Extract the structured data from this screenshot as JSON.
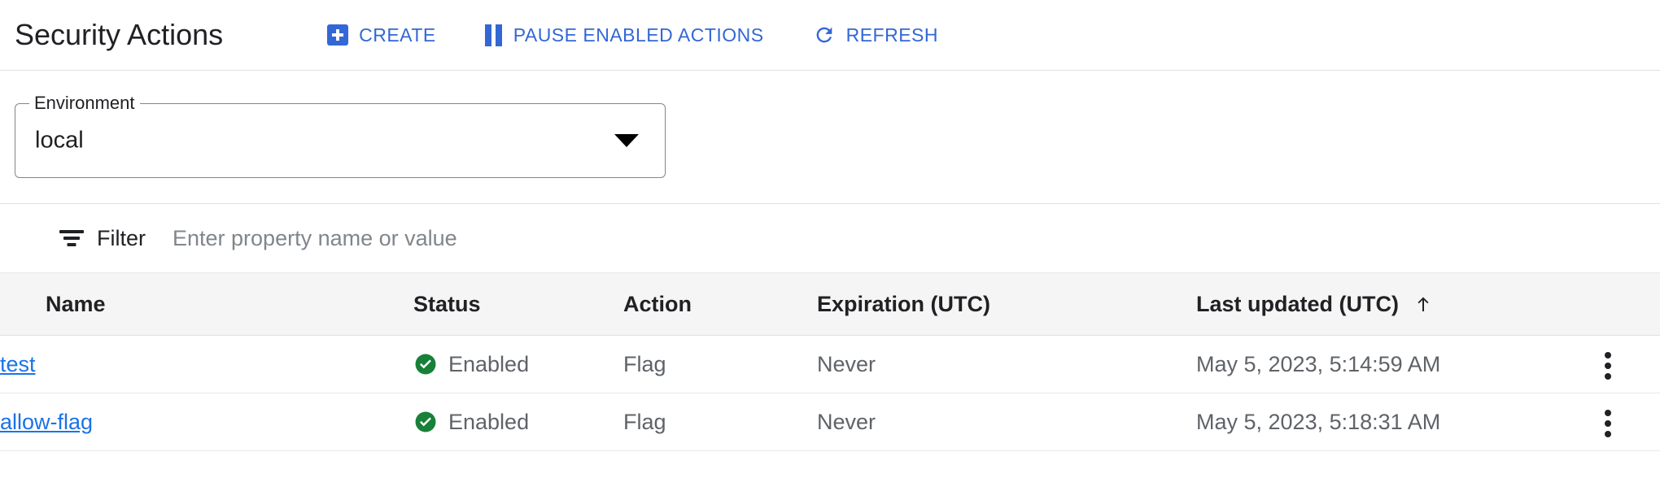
{
  "header": {
    "title": "Security Actions",
    "toolbar": [
      {
        "label": "CREATE",
        "icon": "plus-icon"
      },
      {
        "label": "PAUSE ENABLED ACTIONS",
        "icon": "pause-icon"
      },
      {
        "label": "REFRESH",
        "icon": "refresh-icon"
      }
    ]
  },
  "environment": {
    "legend": "Environment",
    "value": "local",
    "arrow_icon": "chevron-down-icon"
  },
  "filter": {
    "icon": "filter-list-icon",
    "label": "Filter",
    "placeholder": "Enter property name or value",
    "value": ""
  },
  "table": {
    "columns": [
      {
        "key": "name",
        "label": "Name"
      },
      {
        "key": "status",
        "label": "Status"
      },
      {
        "key": "action",
        "label": "Action"
      },
      {
        "key": "expiration",
        "label": "Expiration (UTC)"
      },
      {
        "key": "last_updated",
        "label": "Last updated (UTC)",
        "sort": "ascending",
        "sort_icon": "arrow-upward-icon"
      }
    ],
    "rows": [
      {
        "name": "test",
        "status": "Enabled",
        "status_icon": "check-circle-icon",
        "action": "Flag",
        "expiration": "Never",
        "last_updated": "May 5, 2023, 5:14:59 AM",
        "menu_icon": "more-vert-icon"
      },
      {
        "name": "allow-flag",
        "status": "Enabled",
        "status_icon": "check-circle-icon",
        "action": "Flag",
        "expiration": "Never",
        "last_updated": "May 5, 2023, 5:18:31 AM",
        "menu_icon": "more-vert-icon"
      }
    ]
  },
  "colors": {
    "accent_blue": "#3367d6",
    "link_blue": "#1a73e8",
    "status_green": "#188038",
    "text_primary": "#202124",
    "text_secondary": "#5f6368",
    "header_row_bg": "#f5f5f5",
    "border": "#e0e0e0"
  }
}
